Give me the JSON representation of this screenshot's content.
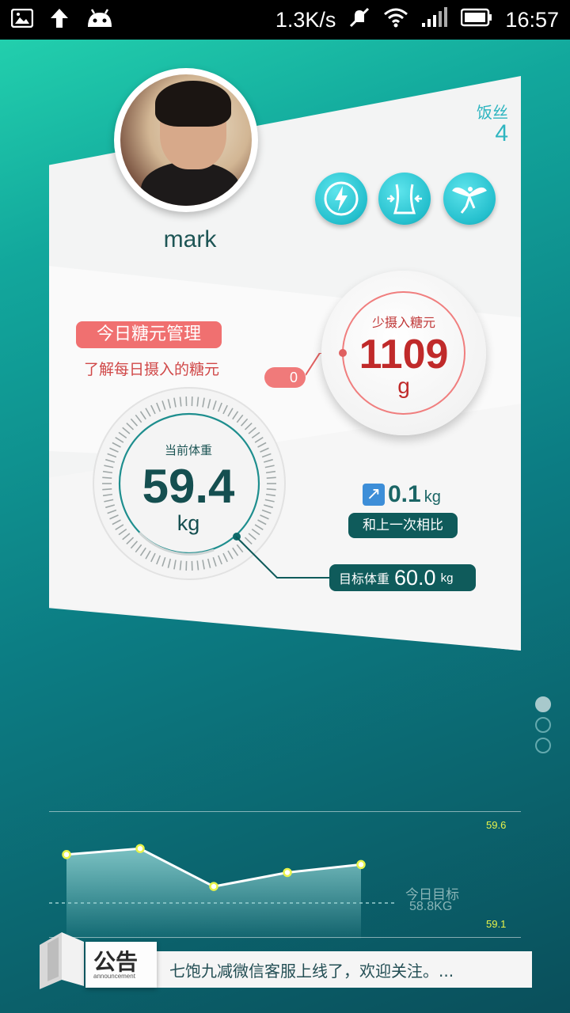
{
  "statusbar": {
    "speed": "1.3K/s",
    "time": "16:57",
    "icons": [
      "image-icon",
      "upload-arrow-icon",
      "android-icon",
      "mute-icon",
      "wifi-icon",
      "signal-icon",
      "battery-icon"
    ]
  },
  "profile": {
    "username": "mark",
    "fans_label": "饭丝",
    "fans_count": "4",
    "badges": [
      "ultimate-winner-badge-icon",
      "waist-slim-badge-icon",
      "angel-badge-icon"
    ]
  },
  "sugar": {
    "title": "今日糖元管理",
    "subtitle": "了解每日摄入的糖元",
    "pill_value": "0",
    "label": "少摄入糖元",
    "value": "1109",
    "unit": "g"
  },
  "weight": {
    "label": "当前体重",
    "value": "59.4",
    "unit": "kg",
    "delta_value": "0.1",
    "delta_unit": "kg",
    "compare_label": "和上一次相比",
    "target_label": "目标体重",
    "target_value": "60.0",
    "target_unit": "kg"
  },
  "pager": {
    "count": 3,
    "active": 0
  },
  "chart_data": {
    "type": "area",
    "values": [
      59.45,
      59.48,
      59.29,
      59.36,
      59.4
    ],
    "ylim": [
      59.1,
      59.6
    ],
    "ytick_labels": [
      "59.6",
      "59.1"
    ],
    "goal_label": "今日目标",
    "goal_value_label": "58.8KG",
    "colors": {
      "line": "#ffffff",
      "marker": "#e8f34a",
      "fill": "#7fc3c3"
    }
  },
  "notice": {
    "title": "公告",
    "subtitle": "announcement",
    "text": "七饱九减微信客服上线了，欢迎关注。..."
  },
  "colors": {
    "accent_teal": "#0f5b5b",
    "accent_red": "#f07070",
    "badge_cyan": "#24bfcd"
  }
}
